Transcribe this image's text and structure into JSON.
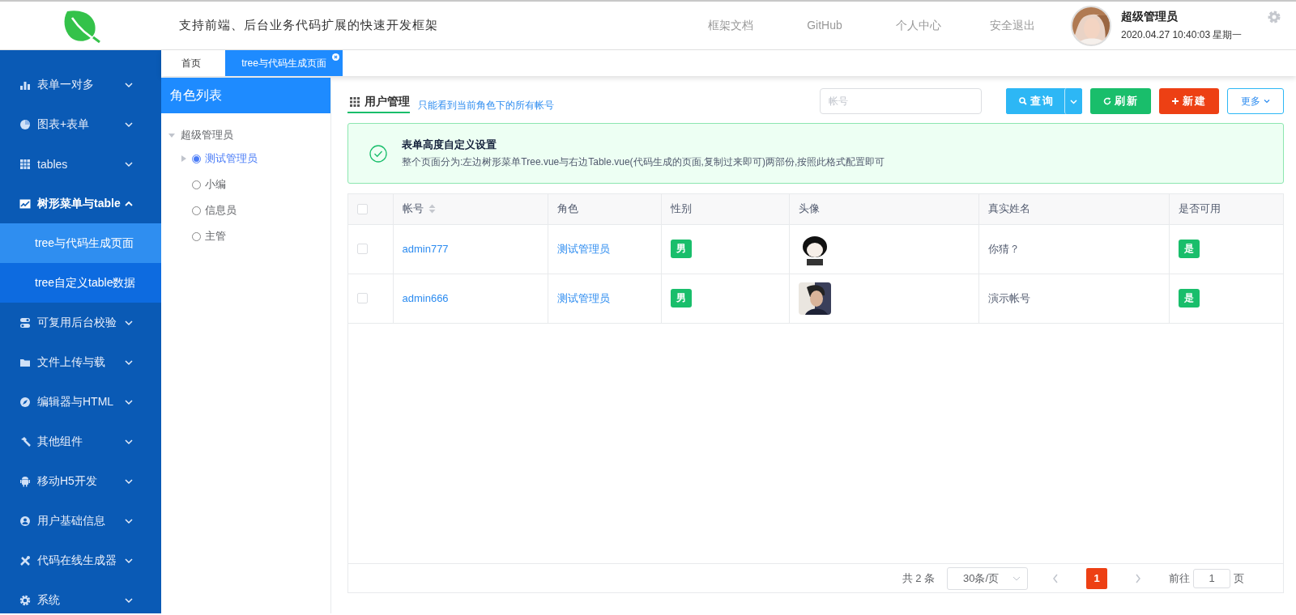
{
  "header": {
    "tagline": "支持前端、后台业务代码扩展的快速开发框架",
    "nav": [
      "框架文档",
      "GitHub",
      "个人中心",
      "安全退出"
    ],
    "user": {
      "name": "超级管理员",
      "datetime": "2020.04.27 10:40:03 星期一"
    }
  },
  "sidebar": {
    "items": [
      {
        "label": "表单一对多",
        "expanded": false
      },
      {
        "label": "图表+表单",
        "expanded": false
      },
      {
        "label": "tables",
        "expanded": false
      },
      {
        "label": "树形菜单与table",
        "expanded": true,
        "children": [
          {
            "label": "tree与代码生成页面",
            "selected": true
          },
          {
            "label": "tree自定义table数据",
            "selected": false
          }
        ]
      },
      {
        "label": "可复用后台校验",
        "expanded": false
      },
      {
        "label": "文件上传与载",
        "expanded": false
      },
      {
        "label": "编辑器与HTML",
        "expanded": false
      },
      {
        "label": "其他组件",
        "expanded": false
      },
      {
        "label": "移动H5开发",
        "expanded": false
      },
      {
        "label": "用户基础信息",
        "expanded": false
      },
      {
        "label": "代码在线生成器",
        "expanded": false
      },
      {
        "label": "系统",
        "expanded": false
      }
    ]
  },
  "tabs": [
    {
      "label": "首页",
      "selected": false,
      "closable": false
    },
    {
      "label": "tree与代码生成页面",
      "selected": true,
      "closable": true
    }
  ],
  "role_panel": {
    "title": "角色列表",
    "tree": [
      {
        "label": "超级管理员",
        "expanded": true,
        "children": [
          {
            "label": "测试管理员",
            "selected": true,
            "kind": "branch"
          },
          {
            "label": "小编",
            "selected": false,
            "kind": "leaf"
          },
          {
            "label": "信息员",
            "selected": false,
            "kind": "leaf"
          },
          {
            "label": "主管",
            "selected": false,
            "kind": "leaf"
          }
        ]
      }
    ]
  },
  "toolbar": {
    "title": "用户管理",
    "hint": "只能看到当前角色下的所有帐号",
    "search": {
      "placeholder": "帐号"
    },
    "buttons": [
      {
        "label": "查询",
        "kind": "query"
      },
      {
        "label": "刷新",
        "kind": "refresh"
      },
      {
        "label": "新建",
        "kind": "create"
      },
      {
        "label": "更多",
        "kind": "more"
      }
    ]
  },
  "alert": {
    "title": "表单高度自定义设置",
    "message": "整个页面分为:左边树形菜单Tree.vue与右边Table.vue(代码生成的页面,复制过来即可)两部份,按照此格式配置即可"
  },
  "table": {
    "header_checked": false,
    "columns": [
      {
        "label": "帐号",
        "sortable": true
      },
      {
        "label": "角色",
        "sortable": false
      },
      {
        "label": "性别",
        "sortable": false
      },
      {
        "label": "头像",
        "sortable": false
      },
      {
        "label": "真实姓名",
        "sortable": false
      },
      {
        "label": "是否可用",
        "sortable": false
      }
    ],
    "rows": [
      {
        "checked": false,
        "account": "admin777",
        "role": "测试管理员",
        "gender": "男",
        "real_name": "你猜？",
        "enabled": "是"
      },
      {
        "checked": false,
        "account": "admin666",
        "role": "测试管理员",
        "gender": "男",
        "real_name": "演示帐号",
        "enabled": "是"
      }
    ]
  },
  "pagination": {
    "total": "共 2 条",
    "page_size": "30条/页",
    "pages": [
      {
        "label": "1",
        "selected": true
      }
    ],
    "goto_label": "前往",
    "goto_value": "1",
    "goto_suffix": "页"
  }
}
